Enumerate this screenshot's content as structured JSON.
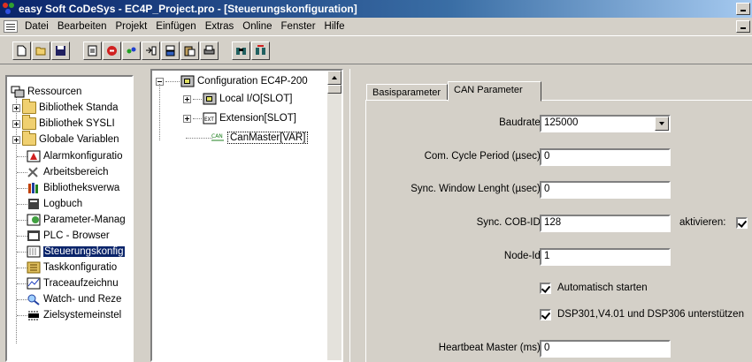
{
  "window": {
    "title": "easy Soft CoDeSys - EC4P_Project.pro - [Steuerungskonfiguration]"
  },
  "menu": [
    "Datei",
    "Bearbeiten",
    "Projekt",
    "Einfügen",
    "Extras",
    "Online",
    "Fenster",
    "Hilfe"
  ],
  "toolbar": {
    "buttons": [
      "new-icon",
      "open-icon",
      "save-icon",
      "build-icon",
      "stop-icon",
      "compile-icon",
      "insert-icon",
      "cut-icon",
      "paste-icon",
      "print-icon",
      "binoculars-icon",
      "replace-icon"
    ]
  },
  "resources": {
    "items": [
      {
        "label": "Ressourcen"
      },
      {
        "label": "Bibliothek Standa"
      },
      {
        "label": "Bibliothek SYSLI"
      },
      {
        "label": "Globale Variablen"
      },
      {
        "label": "Alarmkonfiguratio"
      },
      {
        "label": "Arbeitsbereich"
      },
      {
        "label": "Bibliotheksverwa"
      },
      {
        "label": "Logbuch"
      },
      {
        "label": "Parameter-Manag"
      },
      {
        "label": "PLC - Browser"
      },
      {
        "label": "Steuerungskonfig"
      },
      {
        "label": "Taskkonfiguratio"
      },
      {
        "label": "Traceaufzeichnu"
      },
      {
        "label": "Watch- und Reze"
      },
      {
        "label": "Zielsystemeinstel"
      }
    ]
  },
  "config_tree": {
    "root": "Configuration EC4P-200",
    "children": [
      {
        "label": "Local I/O[SLOT]"
      },
      {
        "label": "Extension[SLOT]"
      },
      {
        "label": "CanMaster[VAR]"
      }
    ]
  },
  "tabs": [
    "Basisparameter",
    "CAN Parameter"
  ],
  "can_params": {
    "baudrate_label": "Baudrate:",
    "baudrate_value": "125000",
    "com_cycle_label": "Com. Cycle Period (µsec):",
    "com_cycle_value": "0",
    "sync_window_label": "Sync. Window Lenght (µsec):",
    "sync_window_value": "0",
    "sync_cob_label": "Sync. COB-ID:",
    "sync_cob_value": "128",
    "aktivieren_label": "aktivieren:",
    "node_id_label": "Node-Id:",
    "node_id_value": "1",
    "auto_start_label": "Automatisch starten",
    "dsp_label": "DSP301,V4.01 und DSP306 unterstützen",
    "heartbeat_label": "Heartbeat Master (ms):",
    "heartbeat_value": "0"
  }
}
